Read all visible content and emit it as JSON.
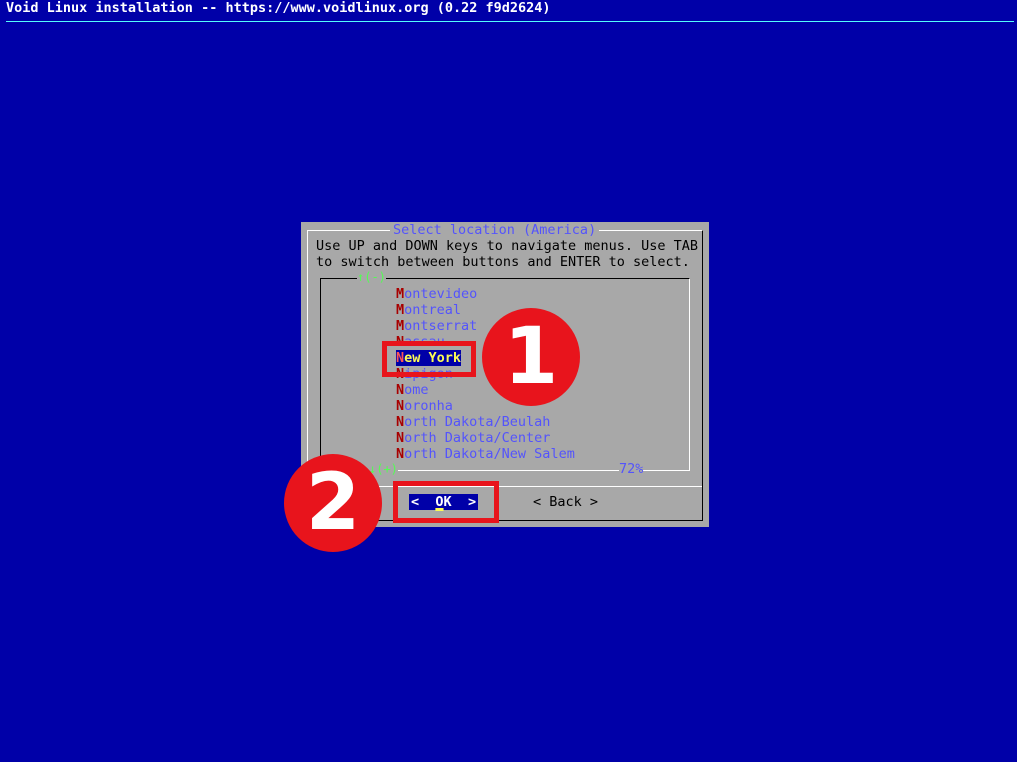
{
  "topbar": {
    "title": "Void Linux installation -- https://www.voidlinux.org (0.22 f9d2624)"
  },
  "dialog": {
    "title": "Select location (America)",
    "instructions": "Use UP and DOWN keys to navigate menus. Use TAB\nto switch between buttons and ENTER to select.",
    "scroll_up": "↑(-)",
    "scroll_down": "↓(+)",
    "percent": "72%",
    "items": [
      {
        "hk": "M",
        "rest": "ontevideo"
      },
      {
        "hk": "M",
        "rest": "ontreal"
      },
      {
        "hk": "M",
        "rest": "ontserrat"
      },
      {
        "hk": "N",
        "rest": "assau"
      },
      {
        "hk": "N",
        "rest": "ew York",
        "selected": true
      },
      {
        "hk": "N",
        "rest": "ipigon"
      },
      {
        "hk": "N",
        "rest": "ome"
      },
      {
        "hk": "N",
        "rest": "oronha"
      },
      {
        "hk": "N",
        "rest": "orth Dakota/Beulah"
      },
      {
        "hk": "N",
        "rest": "orth Dakota/Center"
      },
      {
        "hk": "N",
        "rest": "orth Dakota/New Salem"
      }
    ],
    "buttons": {
      "ok_left": "< ",
      "ok_label_hk": "O",
      "ok_label_rest": "K",
      "ok_right": " >",
      "ok_pad_left": " ",
      "ok_pad_right": " ",
      "back": "< Back >"
    }
  },
  "annotations": {
    "step1": "1",
    "step2": "2",
    "color": "#e8141c"
  },
  "colors": {
    "background": "#0000a8",
    "dialog": "#a8a8a8",
    "title": "#5454fc",
    "hotkey": "#a80000",
    "selected_text": "#fcfc54"
  }
}
